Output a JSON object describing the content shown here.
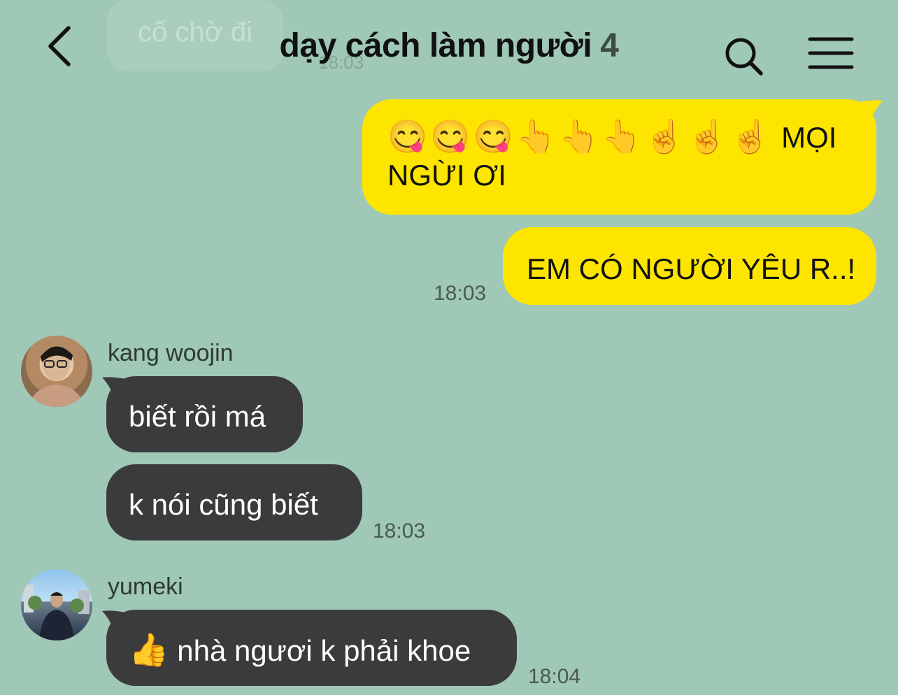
{
  "header": {
    "ghost_bubble_text": "cố chờ đi",
    "ghost_time": "18:03",
    "title": "dạy cách làm người",
    "member_count": "4",
    "icons": {
      "back": "chevron-left-icon",
      "search": "search-icon",
      "menu": "hamburger-menu-icon"
    }
  },
  "messages": [
    {
      "sender": "me",
      "emoji": "😋😋😋👆👆👆☝️☝️☝️",
      "text": "MỌI NGỪI ƠI"
    },
    {
      "sender": "me",
      "text": "EM CÓ NGƯỜI YÊU R..!",
      "time": "18:03"
    },
    {
      "sender": "kang woojin",
      "text": "biết rồi má"
    },
    {
      "sender": "kang woojin",
      "text": "k nói cũng biết",
      "time": "18:03"
    },
    {
      "sender": "yumeki",
      "emoji": "👍",
      "text": "nhà ngươi k phải khoe",
      "time": "18:04"
    }
  ],
  "colors": {
    "background": "#9fc8b6",
    "my_bubble": "#fee500",
    "their_bubble": "#3b3b3d"
  }
}
